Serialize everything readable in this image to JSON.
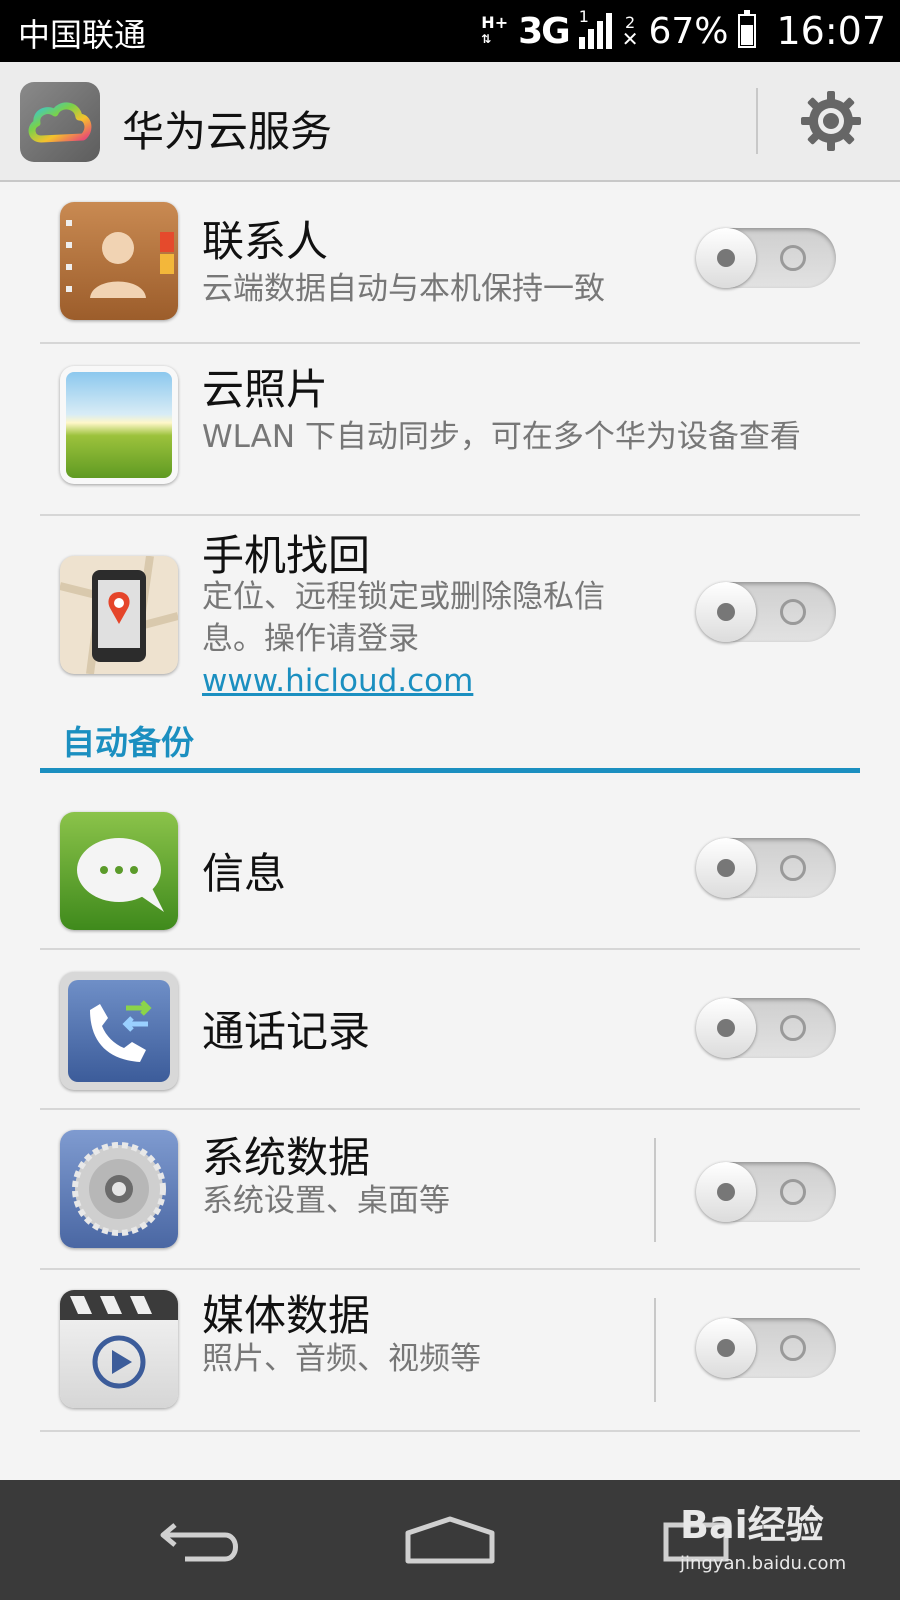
{
  "status_bar": {
    "carrier": "中国联通",
    "net_type": "H+",
    "mobile_gen": "3G",
    "sim1": "1",
    "sim2": "2",
    "battery_percent": "67%",
    "time": "16:07"
  },
  "action_bar": {
    "title": "华为云服务",
    "logo_icon": "cloud-icon",
    "settings_icon": "gear-icon"
  },
  "sync_items": [
    {
      "title": "联系人",
      "subtitle": "云端数据自动与本机保持一致",
      "icon": "contacts-icon",
      "toggle_on": false
    },
    {
      "title": "云照片",
      "subtitle": "WLAN 下自动同步，可在多个华为设备查看",
      "icon": "photos-icon"
    },
    {
      "title": "手机找回",
      "subtitle": "定位、远程锁定或删除隐私信息。操作请登录",
      "link": "www.hicloud.com",
      "icon": "phone-finder-icon",
      "toggle_on": false
    }
  ],
  "backup_section": {
    "header": "自动备份",
    "items": [
      {
        "title": "信息",
        "icon": "messages-icon",
        "toggle_on": false
      },
      {
        "title": "通话记录",
        "icon": "call-log-icon",
        "toggle_on": false
      },
      {
        "title": "系统数据",
        "subtitle": "系统设置、桌面等",
        "icon": "system-data-icon",
        "toggle_on": false
      },
      {
        "title": "媒体数据",
        "subtitle": "照片、音频、视频等",
        "icon": "media-data-icon",
        "toggle_on": false
      }
    ]
  },
  "nav_bar": {
    "back_icon": "back-icon",
    "home_icon": "home-icon",
    "recents_icon": "recents-icon"
  },
  "watermark": {
    "logo": "Bai经验",
    "url": "jingyan.baidu.com"
  }
}
